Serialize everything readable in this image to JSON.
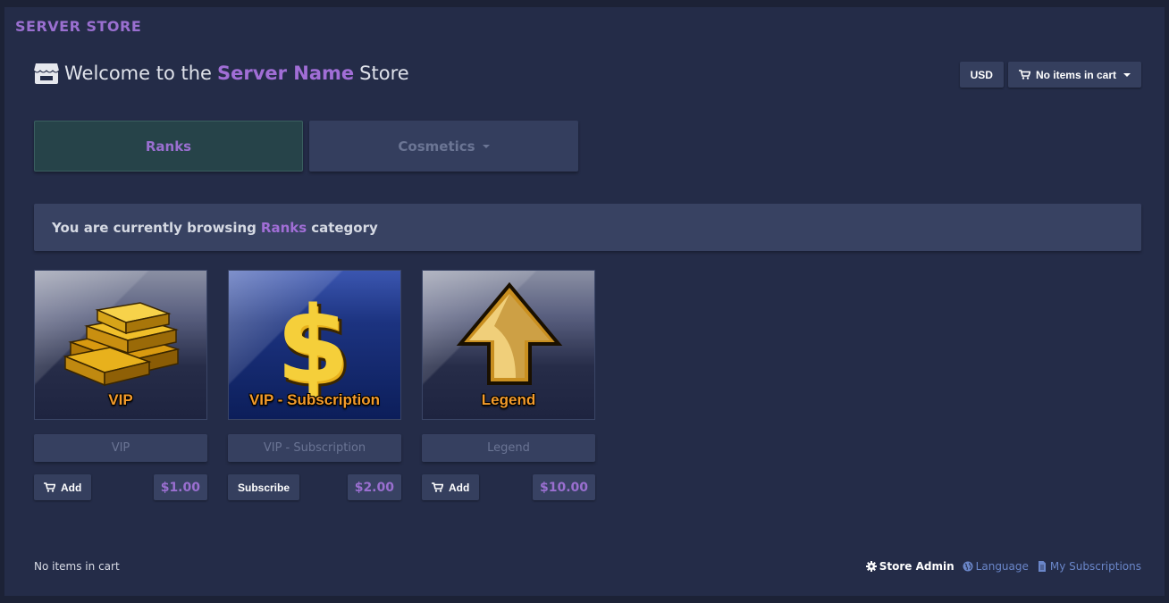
{
  "brand": "SERVER STORE",
  "welcome": {
    "prefix": "Welcome to the",
    "server_name": "Server Name",
    "suffix": "Store"
  },
  "currency": "USD",
  "cart_button": "No items in cart",
  "tabs": [
    {
      "label": "Ranks",
      "active": true
    },
    {
      "label": "Cosmetics",
      "active": false
    }
  ],
  "browse": {
    "prefix": "You are currently browsing",
    "category": "Ranks",
    "suffix": "category"
  },
  "products": [
    {
      "image_caption": "VIP",
      "name": "VIP",
      "action": "Add",
      "price": "$1.00",
      "icon": "gold-bars-icon"
    },
    {
      "image_caption": "VIP - Subscription",
      "name": "VIP - Subscription",
      "action": "Subscribe",
      "price": "$2.00",
      "icon": "dollar-sign-icon"
    },
    {
      "image_caption": "Legend",
      "name": "Legend",
      "action": "Add",
      "price": "$10.00",
      "icon": "up-arrow-icon"
    }
  ],
  "footer": {
    "cart_status": "No items in cart",
    "store_admin": "Store Admin",
    "language": "Language",
    "subscriptions": "My Subscriptions"
  },
  "colors": {
    "accent": "#9a6fd0",
    "background": "#242c48",
    "caption": "#f39b2b"
  }
}
